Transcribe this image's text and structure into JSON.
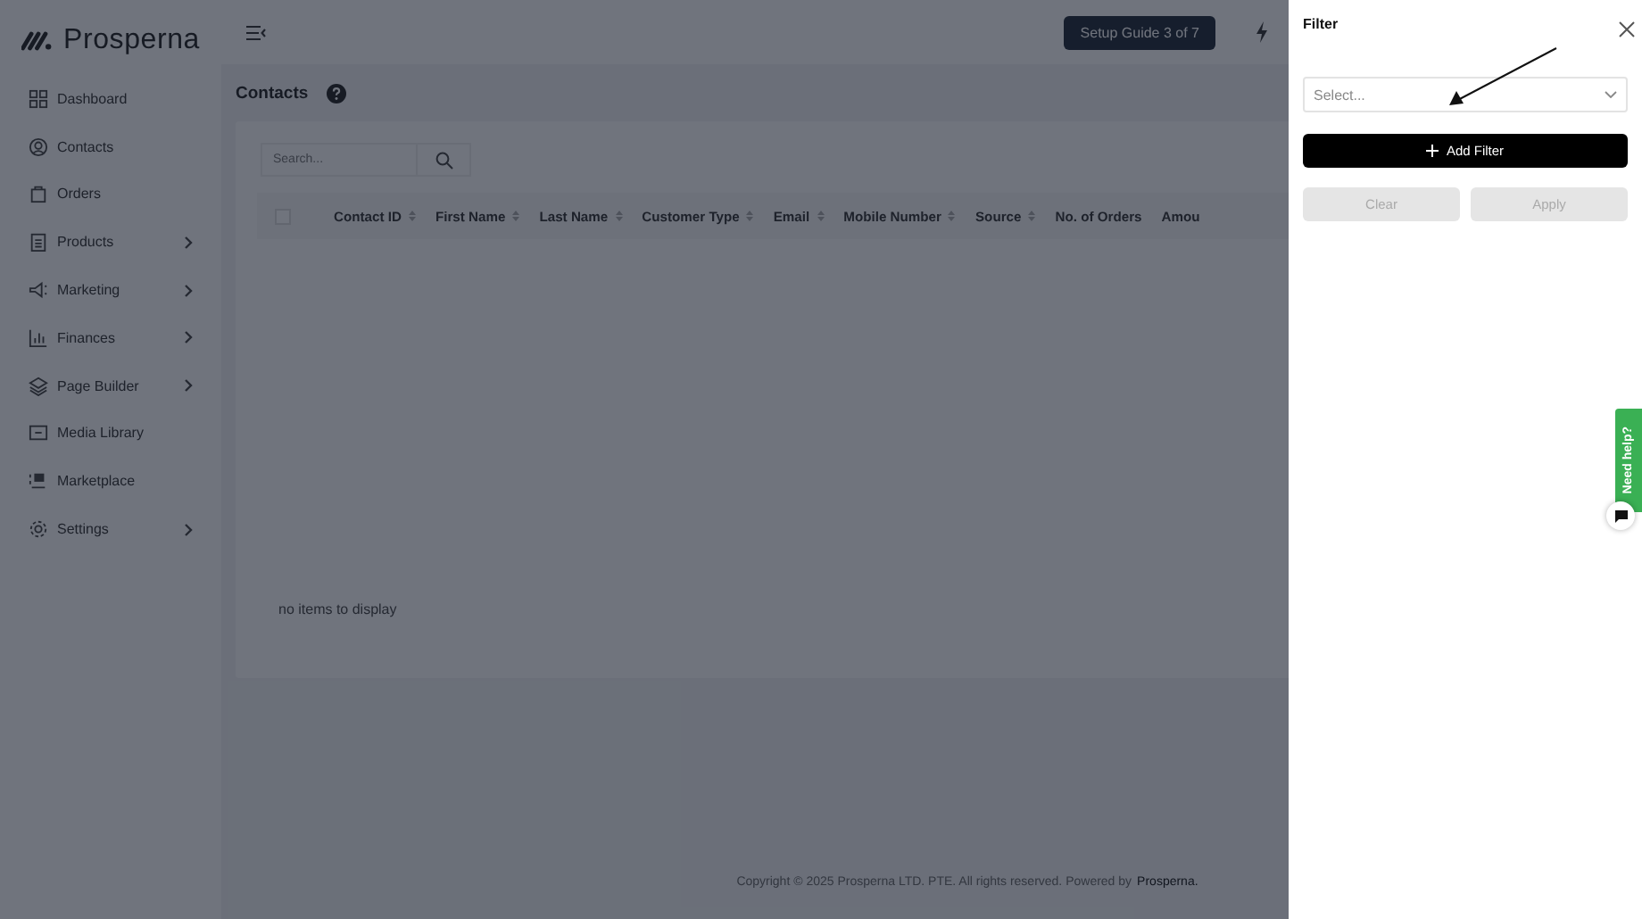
{
  "brand": {
    "name": "Prosperna"
  },
  "topbar": {
    "setup_guide": "Setup Guide 3 of 7"
  },
  "sidebar": {
    "items": [
      {
        "label": "Dashboard",
        "has_submenu": false
      },
      {
        "label": "Contacts",
        "has_submenu": false
      },
      {
        "label": "Orders",
        "has_submenu": false
      },
      {
        "label": "Products",
        "has_submenu": true
      },
      {
        "label": "Marketing",
        "has_submenu": true
      },
      {
        "label": "Finances",
        "has_submenu": true
      },
      {
        "label": "Page Builder",
        "has_submenu": true
      },
      {
        "label": "Media Library",
        "has_submenu": false
      },
      {
        "label": "Marketplace",
        "has_submenu": false
      },
      {
        "label": "Settings",
        "has_submenu": true
      }
    ]
  },
  "page": {
    "title": "Contacts"
  },
  "search": {
    "placeholder": "Search..."
  },
  "table": {
    "select_all_checked": false,
    "columns": [
      {
        "label": "Contact ID",
        "sortable": true
      },
      {
        "label": "First Name",
        "sortable": true
      },
      {
        "label": "Last Name",
        "sortable": true
      },
      {
        "label": "Customer Type",
        "sortable": true
      },
      {
        "label": "Email",
        "sortable": true
      },
      {
        "label": "Mobile Number",
        "sortable": true
      },
      {
        "label": "Source",
        "sortable": true
      },
      {
        "label": "No. of Orders",
        "sortable": false
      },
      {
        "label": "Amou",
        "sortable": false
      }
    ],
    "empty_message": "no items to display"
  },
  "footer": {
    "text": "Copyright © 2025 Prosperna LTD. PTE. All rights reserved. Powered by",
    "link": "Prosperna."
  },
  "filter_panel": {
    "title": "Filter",
    "select": {
      "placeholder": "Select..."
    },
    "buttons": [
      {
        "label": "Add Filter",
        "kind": "primary",
        "disabled": false
      },
      {
        "label": "Clear",
        "kind": "secondary",
        "disabled": true
      },
      {
        "label": "Apply",
        "kind": "secondary",
        "disabled": true
      }
    ]
  },
  "help_tab": {
    "label": "Need help?"
  }
}
